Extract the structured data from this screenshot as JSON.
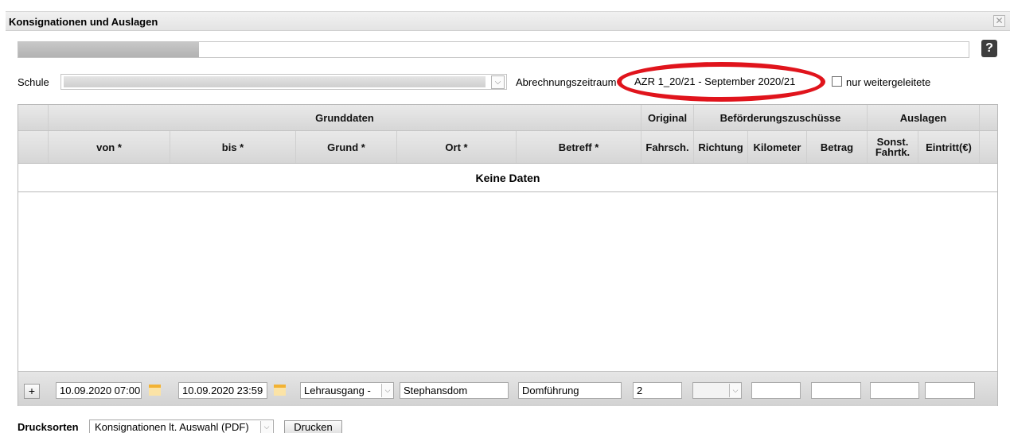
{
  "window": {
    "title": "Konsignationen und Auslagen",
    "close_icon": "close-icon",
    "close_glyph": "✕"
  },
  "progress": {
    "fraction": 0.19
  },
  "help": {
    "label": "?"
  },
  "filters": {
    "schule_label": "Schule",
    "period_label": "Abrechnungszeitraum",
    "period_value": "AZR 1_20/21 - September 2020/21",
    "forwarded_label": "nur weitergeleitete",
    "forwarded_checked": false,
    "highlight_color": "#e0141c"
  },
  "table": {
    "group_headers": {
      "grunddaten": "Grunddaten",
      "original": "Original",
      "befoerderung": "Beförderungszuschüsse",
      "auslagen": "Auslagen"
    },
    "columns": {
      "von": "von *",
      "bis": "bis *",
      "grund": "Grund *",
      "ort": "Ort *",
      "betreff": "Betreff *",
      "fahrsch": "Fahrsch.",
      "richtung": "Richtung",
      "kilometer": "Kilometer",
      "betrag": "Betrag",
      "sonst": "Sonst. Fahrtk.",
      "eintritt": "Eintritt(€)"
    },
    "empty_text": "Keine Daten"
  },
  "edit_row": {
    "add_label": "+",
    "von": "10.09.2020 07:00",
    "bis": "10.09.2020 23:59",
    "grund": "Lehrausgang -",
    "ort": "Stephansdom",
    "betreff": "Domführung",
    "fahrsch": "2",
    "richtung": "",
    "kilometer": "",
    "betrag": "",
    "sonst": "",
    "eintritt": ""
  },
  "footer": {
    "drucksorten_label": "Drucksorten",
    "drucksorten_value": "Konsignationen lt. Auswahl (PDF)",
    "print_label": "Drucken"
  },
  "icons": {
    "dropdown": "chevron-down-icon",
    "calendar": "calendar-icon",
    "help": "help-icon"
  }
}
